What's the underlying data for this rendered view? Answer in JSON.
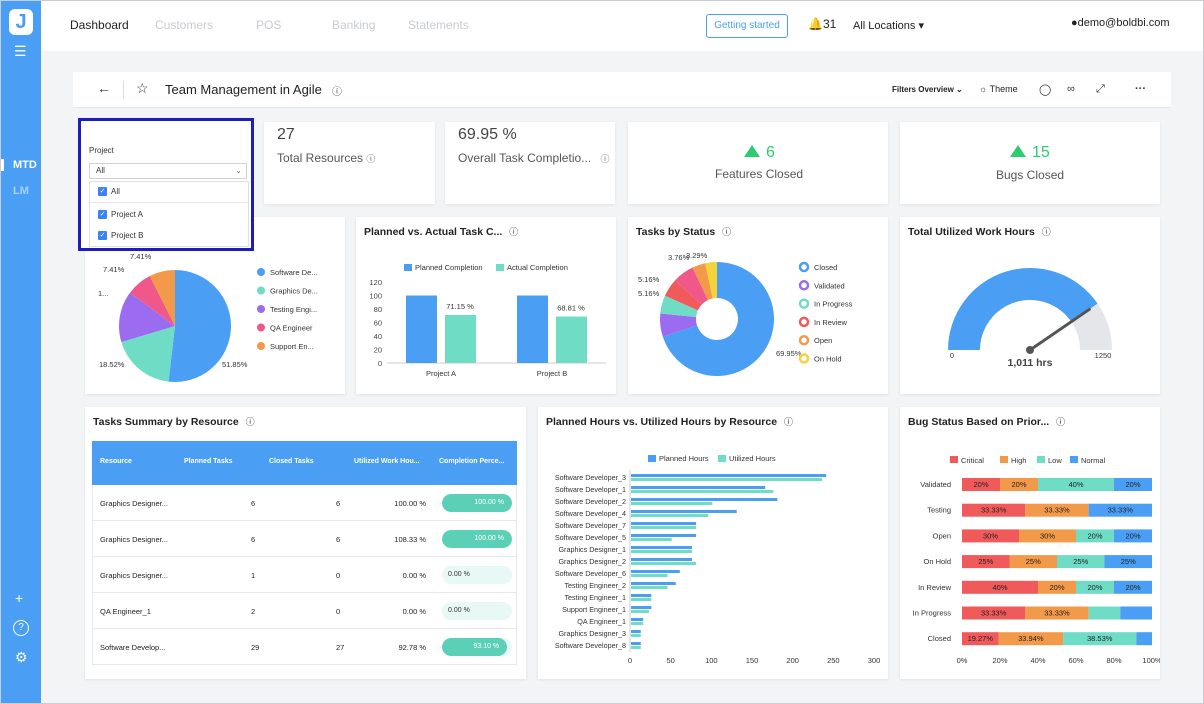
{
  "rail": {
    "logo": "J",
    "mtd": "MTD",
    "lm": "LM"
  },
  "nav": {
    "tabs": [
      "Dashboard",
      "Customers",
      "POS",
      "Banking",
      "Statements"
    ],
    "getting_started": "Getting started",
    "notif_count": "31",
    "location": "All Locations",
    "user": "demo@boldbi.com"
  },
  "dashboard": {
    "title": "Team Management in Agile",
    "filters_overview": "Filters Overview",
    "theme": "Theme"
  },
  "filter": {
    "label": "Project",
    "selected": "All",
    "options": [
      "All",
      "Project A",
      "Project B"
    ]
  },
  "kpis": {
    "total_resources": {
      "value": "27",
      "label": "Total Resources"
    },
    "overall_completion": {
      "value": "69.95 %",
      "label": "Overall Task Completio..."
    },
    "features_closed": {
      "value": "6",
      "label": "Features Closed"
    },
    "bugs_closed": {
      "value": "15",
      "label": "Bugs Closed"
    }
  },
  "colors": {
    "accent": "#4a9ff5",
    "teal": "#5cd0b6",
    "green": "#2ecc71",
    "critical": "#f05a5a",
    "high": "#f39a4a",
    "low": "#6fdcc6",
    "normal": "#4a9ff5"
  },
  "titles": {
    "planned_actual": "Planned vs. Actual Task C...",
    "tasks_by_status": "Tasks by Status",
    "work_hours": "Total Utilized Work Hours",
    "tasks_summary": "Tasks Summary by Resource",
    "hours_by_resource": "Planned Hours vs. Utilized Hours by Resource",
    "bug_status": "Bug Status Based on Prior..."
  },
  "table": {
    "headers": [
      "Resource",
      "Planned Tasks",
      "Closed Tasks",
      "Utilized Work Hou...",
      "Completion Perce..."
    ],
    "rows": [
      {
        "resource": "Graphics Designer...",
        "planned": "6",
        "closed": "6",
        "hours": "100.00 %",
        "completion": "100.00 %",
        "pct": 100
      },
      {
        "resource": "Graphics Designer...",
        "planned": "6",
        "closed": "6",
        "hours": "108.33 %",
        "completion": "100.00 %",
        "pct": 100
      },
      {
        "resource": "Graphics Designer...",
        "planned": "1",
        "closed": "0",
        "hours": "0.00 %",
        "completion": "0.00 %",
        "pct": 0
      },
      {
        "resource": "QA Engineer_1",
        "planned": "2",
        "closed": "0",
        "hours": "0.00 %",
        "completion": "0.00 %",
        "pct": 0
      },
      {
        "resource": "Software Develop...",
        "planned": "29",
        "closed": "27",
        "hours": "92.78 %",
        "completion": "93.10 %",
        "pct": 93.1
      }
    ]
  },
  "chart_data": [
    {
      "type": "pie",
      "id": "resource_pie",
      "slices": [
        {
          "label": "Software De...",
          "value": 51.85,
          "color": "#4a9ff5",
          "text": "51.85%"
        },
        {
          "label": "Graphics De...",
          "value": 18.52,
          "color": "#6fdcc6",
          "text": "18.52%"
        },
        {
          "label": "Testing Engi...",
          "value": 14.81,
          "color": "#9b6cf0",
          "text": "1..."
        },
        {
          "label": "QA Engineer",
          "value": 7.41,
          "color": "#f0588a",
          "text": "7.41%"
        },
        {
          "label": "Support En...",
          "value": 7.41,
          "color": "#f39a4a",
          "text": "7.41%"
        }
      ]
    },
    {
      "type": "bar",
      "id": "planned_actual",
      "categories": [
        "Project A",
        "Project B"
      ],
      "series": [
        {
          "name": "Planned Completion",
          "values": [
            100,
            100
          ],
          "color": "#4a9ff5"
        },
        {
          "name": "Actual Completion",
          "values": [
            71.15,
            68.81
          ],
          "color": "#6fdcc6",
          "labels": [
            "71.15 %",
            "68.81 %"
          ]
        }
      ],
      "ylim": [
        0,
        120
      ],
      "yticks": [
        0,
        20,
        40,
        60,
        80,
        100,
        120
      ]
    },
    {
      "type": "pie",
      "id": "tasks_status",
      "donut": true,
      "slices": [
        {
          "label": "Closed",
          "value": 69.95,
          "color": "#4a9ff5",
          "text": "69.95%"
        },
        {
          "label": "Validated",
          "value": 6.6,
          "color": "#9b6cf0",
          "text": ""
        },
        {
          "label": "In Progress",
          "value": 5.16,
          "color": "#6fdcc6",
          "text": "5.16%"
        },
        {
          "label": "In Review",
          "value": 5.16,
          "color": "#f05a5a",
          "text": "5.16%"
        },
        {
          "label": "Open",
          "value": 3.76,
          "color": "#f39a4a",
          "text": "3.76%"
        },
        {
          "label": "On Hold",
          "value": 3.29,
          "color": "#f5d33a",
          "text": "3.29%"
        },
        {
          "label": "",
          "value": 6.08,
          "color": "#f0588a",
          "text": ""
        }
      ]
    },
    {
      "type": "gauge",
      "id": "work_hours",
      "min": 0,
      "max": 1250,
      "value": 1011,
      "label": "1,011 hrs"
    },
    {
      "type": "bar",
      "id": "hours_by_resource",
      "orientation": "horizontal",
      "categories": [
        "Software Developer_3",
        "Software Developer_1",
        "Software Developer_2",
        "Software Developer_4",
        "Software Developer_7",
        "Software Developer_5",
        "Graphics Designer_1",
        "Graphics Designer_2",
        "Software Developer_6",
        "Testing Engineer_2",
        "Testing Engineer_1",
        "Support Engineer_1",
        "QA Engineer_1",
        "Graphics Designer_3",
        "Software Developer_8"
      ],
      "series": [
        {
          "name": "Planned Hours",
          "values": [
            240,
            165,
            180,
            130,
            80,
            80,
            75,
            75,
            60,
            55,
            25,
            25,
            15,
            12,
            12
          ],
          "color": "#4a9ff5"
        },
        {
          "name": "Utilized Hours",
          "values": [
            235,
            175,
            100,
            95,
            80,
            50,
            75,
            80,
            45,
            45,
            25,
            22,
            15,
            12,
            12
          ],
          "color": "#6fdcc6"
        }
      ],
      "xlim": [
        0,
        300
      ],
      "xticks": [
        0,
        50,
        100,
        150,
        200,
        250,
        300
      ]
    },
    {
      "type": "bar",
      "id": "bug_status",
      "stacked": "percent",
      "categories": [
        "Validated",
        "Testing",
        "Open",
        "On Hold",
        "In Review",
        "In Progress",
        "Closed"
      ],
      "series": [
        {
          "name": "Critical",
          "values": [
            20,
            33.33,
            30,
            25,
            40,
            33.33,
            19.27
          ],
          "color": "#f05a5a"
        },
        {
          "name": "High",
          "values": [
            20,
            33.33,
            30,
            25,
            20,
            33.33,
            33.94
          ],
          "color": "#f39a4a"
        },
        {
          "name": "Low",
          "values": [
            40,
            0,
            20,
            25,
            20,
            16.67,
            38.53
          ],
          "color": "#6fdcc6"
        },
        {
          "name": "Normal",
          "values": [
            20,
            33.33,
            20,
            25,
            20,
            16.67,
            8.26
          ],
          "color": "#4a9ff5"
        }
      ],
      "labels": [
        [
          "20%",
          "20%",
          "40%",
          "20%"
        ],
        [
          "33.33%",
          "33.33%",
          "",
          "33.33%"
        ],
        [
          "30%",
          "30%",
          "20%",
          "20%"
        ],
        [
          "25%",
          "25%",
          "25%",
          "25%"
        ],
        [
          "40%",
          "20%",
          "20%",
          "20%"
        ],
        [
          "33.33%",
          "33.33%",
          "",
          ""
        ],
        [
          "19.27%",
          "33.94%",
          "38.53%",
          ""
        ]
      ],
      "xticks": [
        "0%",
        "20%",
        "40%",
        "60%",
        "80%",
        "100%"
      ]
    }
  ]
}
